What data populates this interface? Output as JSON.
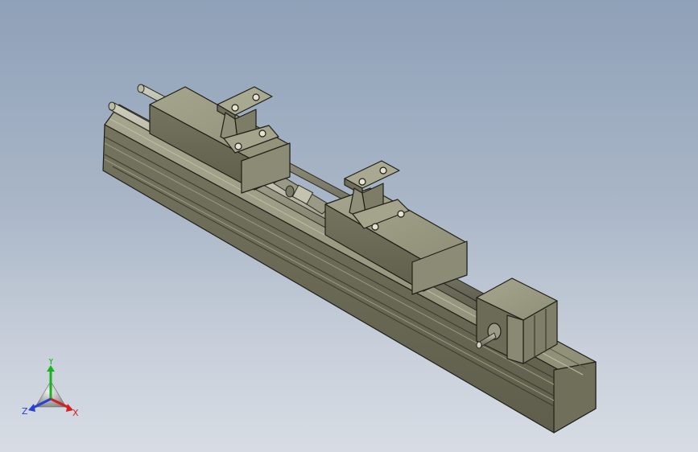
{
  "viewport": {
    "name": "3d-graphics-area"
  },
  "model": {
    "name": "linear-module-assembly"
  },
  "triad": {
    "x_label": "X",
    "y_label": "Y",
    "z_label": "Z",
    "colors": {
      "x": "#d42020",
      "y": "#19b31f",
      "z": "#2b3fd1"
    }
  }
}
